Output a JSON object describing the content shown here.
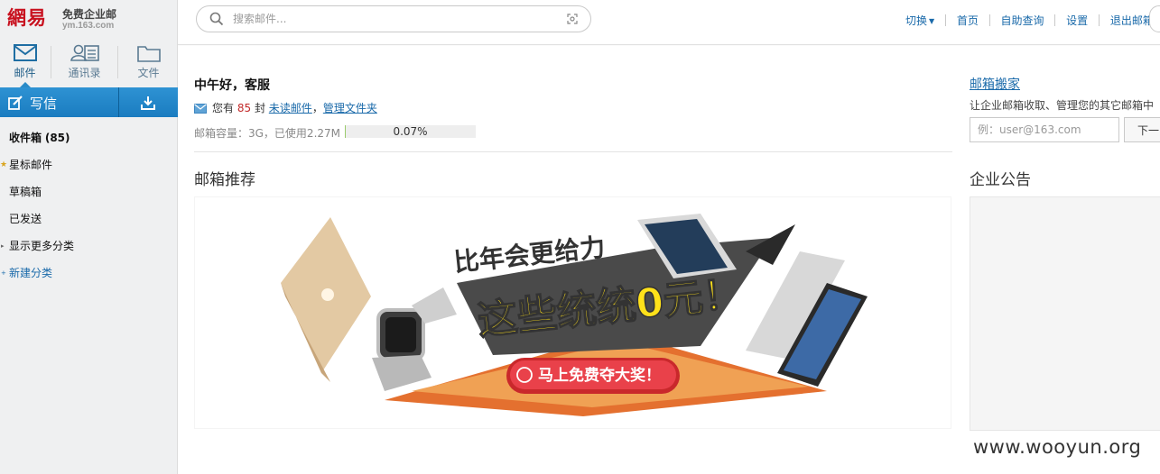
{
  "logo": {
    "brand": "網易",
    "product": "免费企业邮",
    "domain": "ym.163.com"
  },
  "nav": {
    "modules": [
      {
        "label": "邮件",
        "icon": "mail-icon"
      },
      {
        "label": "通讯录",
        "icon": "contacts-icon"
      },
      {
        "label": "文件",
        "icon": "folder-icon"
      }
    ]
  },
  "compose": {
    "label": "写信",
    "icon": "compose-icon",
    "receive_icon": "download-icon"
  },
  "folders": {
    "inbox_label": "收件箱",
    "inbox_count": "(85)",
    "starred": "星标邮件",
    "drafts": "草稿箱",
    "sent": "已发送",
    "more": "显示更多分类",
    "new_folder": "新建分类"
  },
  "search": {
    "placeholder": "搜索邮件..."
  },
  "top_links": [
    "切换",
    "首页",
    "自助查询",
    "设置",
    "退出邮箱"
  ],
  "greeting": "中午好，客服",
  "unread": {
    "prefix": "您有",
    "count": "85",
    "unit": "封",
    "unread_link": "未读邮件",
    "sep": "，",
    "manage_link": "管理文件夹"
  },
  "quota": {
    "label": "邮箱容量：3G，已使用2.27M",
    "percent_text": "0.07%",
    "percent": 0.07
  },
  "recommend_title": "邮箱推荐",
  "banner": {
    "headline": "比年会更给力",
    "main": "这些统统0元！",
    "button": "马上免费夺大奖！"
  },
  "migrate": {
    "link": "邮箱搬家",
    "desc": "让企业邮箱收取、管理您的其它邮箱中",
    "placeholder": "例：user@163.com",
    "next": "下一"
  },
  "notice_title": "企业公告",
  "watermark": "www.wooyun.org",
  "colors": {
    "brand_red": "#c8111f",
    "blue_bar": "#1a7cc0",
    "link": "#1a6aaa",
    "unread_red": "#c32b2b"
  }
}
